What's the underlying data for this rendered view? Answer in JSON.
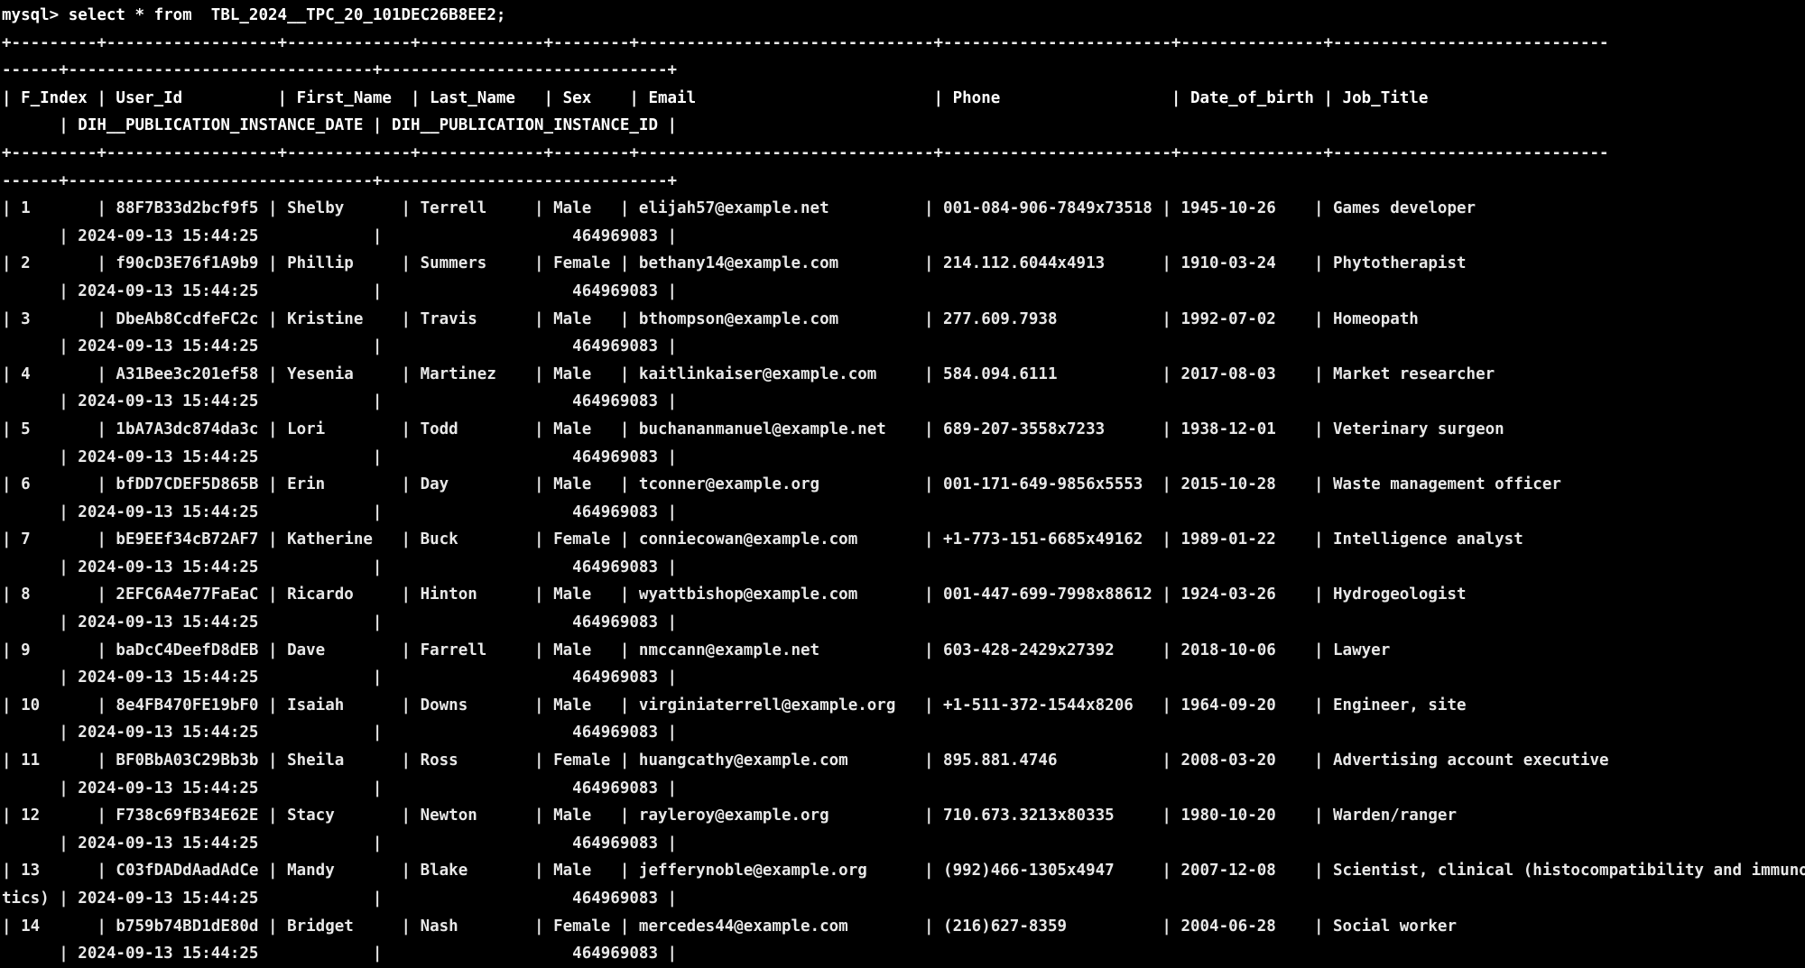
{
  "terminal": {
    "app": "mysql-client",
    "prompt": "mysql>",
    "command": "select * from  TBL_2024__TPC_20_101DEC26B8EE2;",
    "prompt_line": "mysql> select * from  TBL_2024__TPC_20_101DEC26B8EE2;",
    "background_color": "#000000",
    "foreground_color": "#e8e8e8",
    "font_size_px": 17.5,
    "columns_visible": 140,
    "wrapped": true
  },
  "table": {
    "name": "TBL_2024__TPC_20_101DEC26B8EE2",
    "columns": [
      "F_Index",
      "User_Id",
      "First_Name",
      "Last_Name",
      "Sex",
      "Email",
      "Phone",
      "Date_of_birth",
      "Job_Title",
      "DIH__PUBLICATION_INSTANCE_DATE",
      "DIH__PUBLICATION_INSTANCE_ID"
    ],
    "border_top": "+---------+------------------+-------------+-------------+--------+-------------------------------+------------------------+---------------+---------------------------------------------------------------+--------------------------------+------------------------------+",
    "border_head": "+---------+------------------+-------------+-------------+--------+-------------------------------+------------------------+---------------+---------------------------------------------------------------+--------------------------------+------------------------------+",
    "header_row_1": "| F_Index | User_Id          | First_Name  | Last_Name   | Sex    | Email                         | Phone                  | Date_of_birth | Job_Title",
    "header_row_2": "      | DIH__PUBLICATION_INSTANCE_DATE | DIH__PUBLICATION_INSTANCE_ID |",
    "rows": [
      {
        "F_Index": "1",
        "User_Id": "88F7B33d2bcf9f5",
        "First_Name": "Shelby",
        "Last_Name": "Terrell",
        "Sex": "Male",
        "Email": "elijah57@example.net",
        "Phone": "001-084-906-7849x73518",
        "Date_of_birth": "1945-10-26",
        "Job_Title": "Games developer",
        "DIH__PUBLICATION_INSTANCE_DATE": "2024-09-13 15:44:25",
        "DIH__PUBLICATION_INSTANCE_ID": "464969083"
      },
      {
        "F_Index": "2",
        "User_Id": "f90cD3E76f1A9b9",
        "First_Name": "Phillip",
        "Last_Name": "Summers",
        "Sex": "Female",
        "Email": "bethany14@example.com",
        "Phone": "214.112.6044x4913",
        "Date_of_birth": "1910-03-24",
        "Job_Title": "Phytotherapist",
        "DIH__PUBLICATION_INSTANCE_DATE": "2024-09-13 15:44:25",
        "DIH__PUBLICATION_INSTANCE_ID": "464969083"
      },
      {
        "F_Index": "3",
        "User_Id": "DbeAb8CcdfeFC2c",
        "First_Name": "Kristine",
        "Last_Name": "Travis",
        "Sex": "Male",
        "Email": "bthompson@example.com",
        "Phone": "277.609.7938",
        "Date_of_birth": "1992-07-02",
        "Job_Title": "Homeopath",
        "DIH__PUBLICATION_INSTANCE_DATE": "2024-09-13 15:44:25",
        "DIH__PUBLICATION_INSTANCE_ID": "464969083"
      },
      {
        "F_Index": "4",
        "User_Id": "A31Bee3c201ef58",
        "First_Name": "Yesenia",
        "Last_Name": "Martinez",
        "Sex": "Male",
        "Email": "kaitlinkaiser@example.com",
        "Phone": "584.094.6111",
        "Date_of_birth": "2017-08-03",
        "Job_Title": "Market researcher",
        "DIH__PUBLICATION_INSTANCE_DATE": "2024-09-13 15:44:25",
        "DIH__PUBLICATION_INSTANCE_ID": "464969083"
      },
      {
        "F_Index": "5",
        "User_Id": "1bA7A3dc874da3c",
        "First_Name": "Lori",
        "Last_Name": "Todd",
        "Sex": "Male",
        "Email": "buchananmanuel@example.net",
        "Phone": "689-207-3558x7233",
        "Date_of_birth": "1938-12-01",
        "Job_Title": "Veterinary surgeon",
        "DIH__PUBLICATION_INSTANCE_DATE": "2024-09-13 15:44:25",
        "DIH__PUBLICATION_INSTANCE_ID": "464969083"
      },
      {
        "F_Index": "6",
        "User_Id": "bfDD7CDEF5D865B",
        "First_Name": "Erin",
        "Last_Name": "Day",
        "Sex": "Male",
        "Email": "tconner@example.org",
        "Phone": "001-171-649-9856x5553",
        "Date_of_birth": "2015-10-28",
        "Job_Title": "Waste management officer",
        "DIH__PUBLICATION_INSTANCE_DATE": "2024-09-13 15:44:25",
        "DIH__PUBLICATION_INSTANCE_ID": "464969083"
      },
      {
        "F_Index": "7",
        "User_Id": "bE9EEf34cB72AF7",
        "First_Name": "Katherine",
        "Last_Name": "Buck",
        "Sex": "Female",
        "Email": "conniecowan@example.com",
        "Phone": "+1-773-151-6685x49162",
        "Date_of_birth": "1989-01-22",
        "Job_Title": "Intelligence analyst",
        "DIH__PUBLICATION_INSTANCE_DATE": "2024-09-13 15:44:25",
        "DIH__PUBLICATION_INSTANCE_ID": "464969083"
      },
      {
        "F_Index": "8",
        "User_Id": "2EFC6A4e77FaEaC",
        "First_Name": "Ricardo",
        "Last_Name": "Hinton",
        "Sex": "Male",
        "Email": "wyattbishop@example.com",
        "Phone": "001-447-699-7998x88612",
        "Date_of_birth": "1924-03-26",
        "Job_Title": "Hydrogeologist",
        "DIH__PUBLICATION_INSTANCE_DATE": "2024-09-13 15:44:25",
        "DIH__PUBLICATION_INSTANCE_ID": "464969083"
      },
      {
        "F_Index": "9",
        "User_Id": "baDcC4DeefD8dEB",
        "First_Name": "Dave",
        "Last_Name": "Farrell",
        "Sex": "Male",
        "Email": "nmccann@example.net",
        "Phone": "603-428-2429x27392",
        "Date_of_birth": "2018-10-06",
        "Job_Title": "Lawyer",
        "DIH__PUBLICATION_INSTANCE_DATE": "2024-09-13 15:44:25",
        "DIH__PUBLICATION_INSTANCE_ID": "464969083"
      },
      {
        "F_Index": "10",
        "User_Id": "8e4FB470FE19bF0",
        "First_Name": "Isaiah",
        "Last_Name": "Downs",
        "Sex": "Male",
        "Email": "virginiaterrell@example.org",
        "Phone": "+1-511-372-1544x8206",
        "Date_of_birth": "1964-09-20",
        "Job_Title": "Engineer, site",
        "DIH__PUBLICATION_INSTANCE_DATE": "2024-09-13 15:44:25",
        "DIH__PUBLICATION_INSTANCE_ID": "464969083"
      },
      {
        "F_Index": "11",
        "User_Id": "BF0BbA03C29Bb3b",
        "First_Name": "Sheila",
        "Last_Name": "Ross",
        "Sex": "Female",
        "Email": "huangcathy@example.com",
        "Phone": "895.881.4746",
        "Date_of_birth": "2008-03-20",
        "Job_Title": "Advertising account executive",
        "DIH__PUBLICATION_INSTANCE_DATE": "2024-09-13 15:44:25",
        "DIH__PUBLICATION_INSTANCE_ID": "464969083"
      },
      {
        "F_Index": "12",
        "User_Id": "F738c69fB34E62E",
        "First_Name": "Stacy",
        "Last_Name": "Newton",
        "Sex": "Male",
        "Email": "rayleroy@example.org",
        "Phone": "710.673.3213x80335",
        "Date_of_birth": "1980-10-20",
        "Job_Title": "Warden/ranger",
        "DIH__PUBLICATION_INSTANCE_DATE": "2024-09-13 15:44:25",
        "DIH__PUBLICATION_INSTANCE_ID": "464969083"
      },
      {
        "F_Index": "13",
        "User_Id": "C03fDADdAadAdCe",
        "First_Name": "Mandy",
        "Last_Name": "Blake",
        "Sex": "Male",
        "Email": "jefferynoble@example.org",
        "Phone": "(992)466-1305x4947",
        "Date_of_birth": "2007-12-08",
        "Job_Title": "Scientist, clinical (histocompatibility and immunogenetics)",
        "DIH__PUBLICATION_INSTANCE_DATE": "2024-09-13 15:44:25",
        "DIH__PUBLICATION_INSTANCE_ID": "464969083"
      },
      {
        "F_Index": "14",
        "User_Id": "b759b74BD1dE80d",
        "First_Name": "Bridget",
        "Last_Name": "Nash",
        "Sex": "Female",
        "Email": "mercedes44@example.com",
        "Phone": "(216)627-8359",
        "Date_of_birth": "2004-06-28",
        "Job_Title": "Social worker",
        "DIH__PUBLICATION_INSTANCE_DATE": "2024-09-13 15:44:25",
        "DIH__PUBLICATION_INSTANCE_ID": "464969083"
      }
    ]
  },
  "screen_lines": [
    {
      "kind": "prompt",
      "text": "mysql> select * from  TBL_2024__TPC_20_101DEC26B8EE2;"
    },
    {
      "kind": "rule",
      "text": "+---------+------------------+-------------+-------------+--------+-------------------------------+------------------------+---------------+-----------------------------"
    },
    {
      "kind": "rule",
      "text": "------+--------------------------------+------------------------------+"
    },
    {
      "kind": "head",
      "text": "| F_Index | User_Id          | First_Name  | Last_Name   | Sex    | Email                         | Phone                  | Date_of_birth | Job_Title"
    },
    {
      "kind": "head",
      "text": "      | DIH__PUBLICATION_INSTANCE_DATE | DIH__PUBLICATION_INSTANCE_ID |"
    },
    {
      "kind": "rule",
      "text": "+---------+------------------+-------------+-------------+--------+-------------------------------+------------------------+---------------+-----------------------------"
    },
    {
      "kind": "rule",
      "text": "------+--------------------------------+------------------------------+"
    },
    {
      "kind": "data",
      "text": "| 1       | 88F7B33d2bcf9f5 | Shelby      | Terrell     | Male   | elijah57@example.net          | 001-084-906-7849x73518 | 1945-10-26    | Games developer"
    },
    {
      "kind": "data",
      "text": "      | 2024-09-13 15:44:25            |                    464969083 |"
    },
    {
      "kind": "data",
      "text": "| 2       | f90cD3E76f1A9b9 | Phillip     | Summers     | Female | bethany14@example.com         | 214.112.6044x4913      | 1910-03-24    | Phytotherapist"
    },
    {
      "kind": "data",
      "text": "      | 2024-09-13 15:44:25            |                    464969083 |"
    },
    {
      "kind": "data",
      "text": "| 3       | DbeAb8CcdfeFC2c | Kristine    | Travis      | Male   | bthompson@example.com         | 277.609.7938           | 1992-07-02    | Homeopath"
    },
    {
      "kind": "data",
      "text": "      | 2024-09-13 15:44:25            |                    464969083 |"
    },
    {
      "kind": "data",
      "text": "| 4       | A31Bee3c201ef58 | Yesenia     | Martinez    | Male   | kaitlinkaiser@example.com     | 584.094.6111           | 2017-08-03    | Market researcher"
    },
    {
      "kind": "data",
      "text": "      | 2024-09-13 15:44:25            |                    464969083 |"
    },
    {
      "kind": "data",
      "text": "| 5       | 1bA7A3dc874da3c | Lori        | Todd        | Male   | buchananmanuel@example.net    | 689-207-3558x7233      | 1938-12-01    | Veterinary surgeon"
    },
    {
      "kind": "data",
      "text": "      | 2024-09-13 15:44:25            |                    464969083 |"
    },
    {
      "kind": "data",
      "text": "| 6       | bfDD7CDEF5D865B | Erin        | Day         | Male   | tconner@example.org           | 001-171-649-9856x5553  | 2015-10-28    | Waste management officer"
    },
    {
      "kind": "data",
      "text": "      | 2024-09-13 15:44:25            |                    464969083 |"
    },
    {
      "kind": "data",
      "text": "| 7       | bE9EEf34cB72AF7 | Katherine   | Buck        | Female | conniecowan@example.com       | +1-773-151-6685x49162  | 1989-01-22    | Intelligence analyst"
    },
    {
      "kind": "data",
      "text": "      | 2024-09-13 15:44:25            |                    464969083 |"
    },
    {
      "kind": "data",
      "text": "| 8       | 2EFC6A4e77FaEaC | Ricardo     | Hinton      | Male   | wyattbishop@example.com       | 001-447-699-7998x88612 | 1924-03-26    | Hydrogeologist"
    },
    {
      "kind": "data",
      "text": "      | 2024-09-13 15:44:25            |                    464969083 |"
    },
    {
      "kind": "data",
      "text": "| 9       | baDcC4DeefD8dEB | Dave        | Farrell     | Male   | nmccann@example.net           | 603-428-2429x27392     | 2018-10-06    | Lawyer"
    },
    {
      "kind": "data",
      "text": "      | 2024-09-13 15:44:25            |                    464969083 |"
    },
    {
      "kind": "data",
      "text": "| 10      | 8e4FB470FE19bF0 | Isaiah      | Downs       | Male   | virginiaterrell@example.org   | +1-511-372-1544x8206   | 1964-09-20    | Engineer, site"
    },
    {
      "kind": "data",
      "text": "      | 2024-09-13 15:44:25            |                    464969083 |"
    },
    {
      "kind": "data",
      "text": "| 11      | BF0BbA03C29Bb3b | Sheila      | Ross        | Female | huangcathy@example.com        | 895.881.4746           | 2008-03-20    | Advertising account executive"
    },
    {
      "kind": "data",
      "text": "      | 2024-09-13 15:44:25            |                    464969083 |"
    },
    {
      "kind": "data",
      "text": "| 12      | F738c69fB34E62E | Stacy       | Newton      | Male   | rayleroy@example.org          | 710.673.3213x80335     | 1980-10-20    | Warden/ranger"
    },
    {
      "kind": "data",
      "text": "      | 2024-09-13 15:44:25            |                    464969083 |"
    },
    {
      "kind": "data",
      "text": "| 13      | C03fDADdAadAdCe | Mandy       | Blake       | Male   | jefferynoble@example.org      | (992)466-1305x4947     | 2007-12-08    | Scientist, clinical (histocompatibility and immunogene"
    },
    {
      "kind": "data",
      "text": "tics) | 2024-09-13 15:44:25            |                    464969083 |"
    },
    {
      "kind": "data",
      "text": "| 14      | b759b74BD1dE80d | Bridget     | Nash        | Female | mercedes44@example.com        | (216)627-8359          | 2004-06-28    | Social worker"
    },
    {
      "kind": "data",
      "text": "      | 2024-09-13 15:44:25            |                    464969083 |"
    }
  ]
}
